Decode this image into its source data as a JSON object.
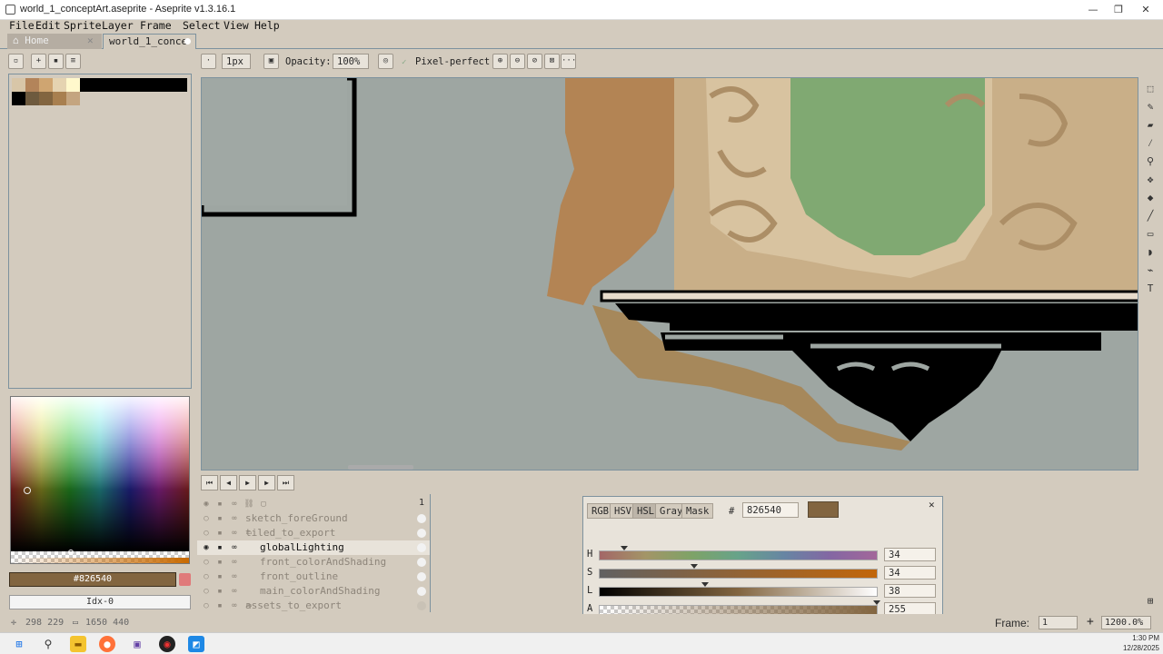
{
  "window": {
    "title": "world_1_conceptArt.aseprite - Aseprite v1.3.16.1",
    "minimize": "—",
    "restore": "❐",
    "close": "✕"
  },
  "menu": [
    "File",
    "Edit",
    "Sprite",
    "Layer",
    "Frame",
    "Select",
    "View",
    "Help"
  ],
  "tabs": {
    "home": "Home",
    "document": "world_1_conce"
  },
  "toolbar": {
    "brush_size": "1px",
    "opacity_label": "Opacity:",
    "opacity_value": "100%",
    "pixel_perfect_label": "Pixel-perfect",
    "more": "···"
  },
  "palette": {
    "colors": [
      "#d8c6a8",
      "#b3845a",
      "#cfa571",
      "#e5d3b1",
      "#fff8cc",
      "#000000",
      "#6e5a3e",
      "#826540",
      "#a87f4f",
      "#c4a580"
    ]
  },
  "color_picker": {
    "fg_hex": "#826540",
    "bg_label": "Idx-0"
  },
  "timeline": {
    "frame_number": "1"
  },
  "layers": [
    {
      "name": "sketch_foreGround",
      "type": "layer",
      "visible": false,
      "active": false,
      "indent": 0
    },
    {
      "name": "tiled_to_export",
      "type": "group",
      "visible": false,
      "active": false,
      "indent": 0
    },
    {
      "name": "globalLighting",
      "type": "layer",
      "visible": true,
      "active": true,
      "indent": 1
    },
    {
      "name": "front_colorAndShading",
      "type": "layer",
      "visible": false,
      "active": false,
      "indent": 1
    },
    {
      "name": "front_outline",
      "type": "layer",
      "visible": false,
      "active": false,
      "indent": 1
    },
    {
      "name": "main_colorAndShading",
      "type": "layer",
      "visible": false,
      "active": false,
      "indent": 1
    },
    {
      "name": "assets_to_export",
      "type": "group",
      "visible": false,
      "active": false,
      "indent": 0
    }
  ],
  "color_popup": {
    "tabs": [
      "RGB",
      "HSV",
      "HSL",
      "Gray",
      "Mask"
    ],
    "active_tab": "HSL",
    "hash": "#",
    "hex_value": "826540",
    "swatch": "#826540",
    "sliders": [
      {
        "label": "H",
        "value": "34",
        "level": 0.09
      },
      {
        "label": "S",
        "value": "34",
        "level": 0.34
      },
      {
        "label": "L",
        "value": "38",
        "level": 0.38
      },
      {
        "label": "A",
        "value": "255",
        "level": 1.0
      }
    ],
    "close": "✕"
  },
  "status": {
    "coords": "298 229",
    "size": "1650 440",
    "frame_label": "Frame:",
    "frame_value": "1",
    "zoom": "1200.0%"
  },
  "taskbar": {
    "time": "1:30 PM",
    "date": "12/28/2025"
  }
}
